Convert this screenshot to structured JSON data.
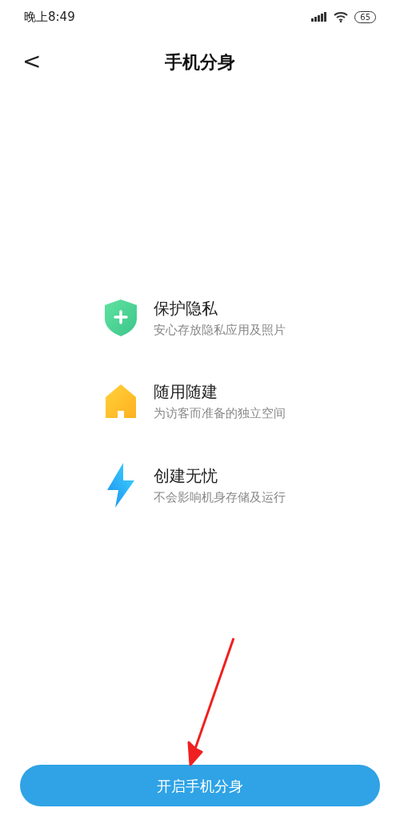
{
  "status_bar": {
    "time": "晚上8:49",
    "battery": "65"
  },
  "header": {
    "back": "<",
    "title": "手机分身"
  },
  "features": [
    {
      "kind": "shield",
      "title": "保护隐私",
      "subtitle": "安心存放隐私应用及照片"
    },
    {
      "kind": "house",
      "title": "随用随建",
      "subtitle": "为访客而准备的独立空间"
    },
    {
      "kind": "bolt",
      "title": "创建无忧",
      "subtitle": "不会影响机身存储及运行"
    }
  ],
  "button": {
    "label": "开启手机分身"
  }
}
